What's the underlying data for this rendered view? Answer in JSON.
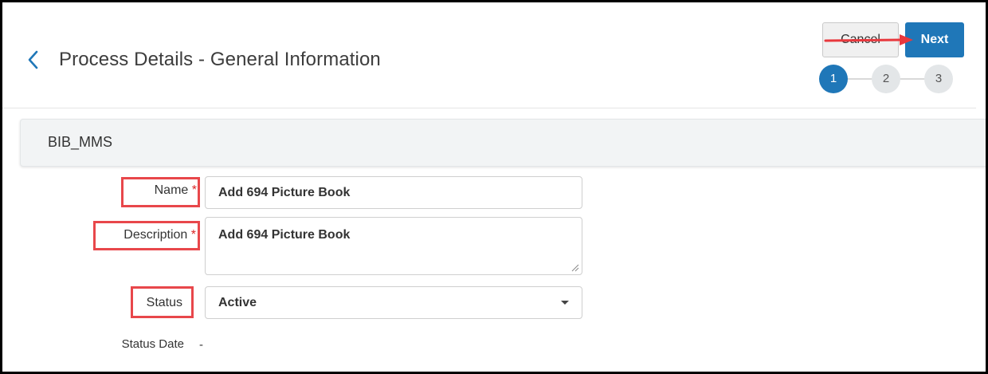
{
  "header": {
    "title": "Process Details - General Information",
    "cancel_label": "Cancel",
    "next_label": "Next",
    "steps": [
      "1",
      "2",
      "3"
    ],
    "active_step": 1
  },
  "section": {
    "title": "BIB_MMS"
  },
  "form": {
    "name": {
      "label": "Name",
      "required_mark": "*",
      "value": "Add 694 Picture Book"
    },
    "description": {
      "label": "Description",
      "required_mark": "*",
      "value": "Add 694 Picture Book"
    },
    "status": {
      "label": "Status",
      "value": "Active"
    },
    "status_date": {
      "label": "Status Date",
      "value": "-"
    }
  },
  "colors": {
    "primary": "#1f77b8",
    "highlight": "#e8474b",
    "required": "#d92626"
  },
  "icons": {
    "back": "chevron-left-icon",
    "dropdown": "caret-down-icon",
    "annotation": "arrow-right-icon"
  }
}
